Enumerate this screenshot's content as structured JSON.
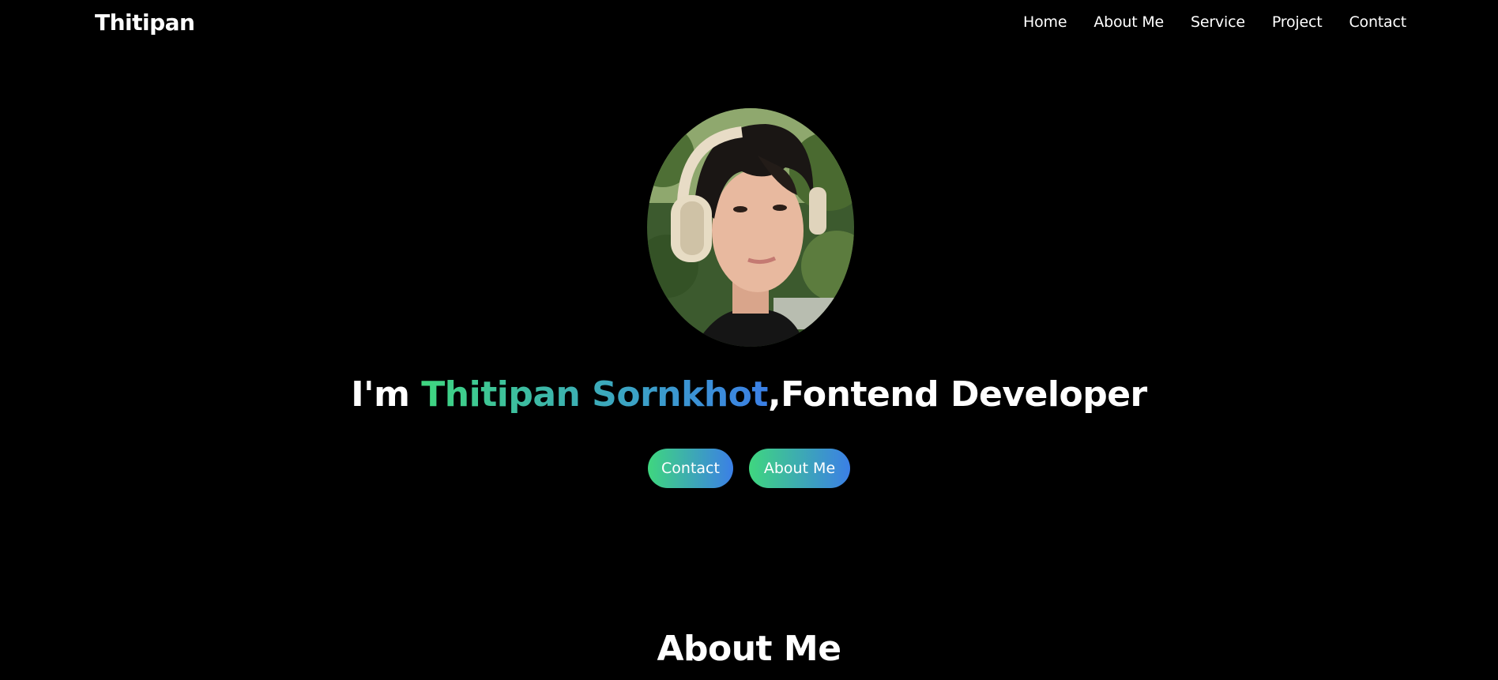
{
  "header": {
    "logo": "Thitipan",
    "nav": [
      {
        "label": "Home"
      },
      {
        "label": "About Me"
      },
      {
        "label": "Service"
      },
      {
        "label": "Project"
      },
      {
        "label": "Contact"
      }
    ]
  },
  "hero": {
    "avatar_alt": "profile-photo",
    "headline_prefix": "I'm ",
    "headline_name": "Thitipan Sornkhot",
    "headline_suffix": ",Fontend Developer",
    "buttons": {
      "contact": "Contact",
      "about": "About Me"
    }
  },
  "about": {
    "title": "About Me"
  },
  "colors": {
    "background": "#000000",
    "text": "#ffffff",
    "gradient_start": "#3fd67f",
    "gradient_end": "#3b7fe6"
  }
}
